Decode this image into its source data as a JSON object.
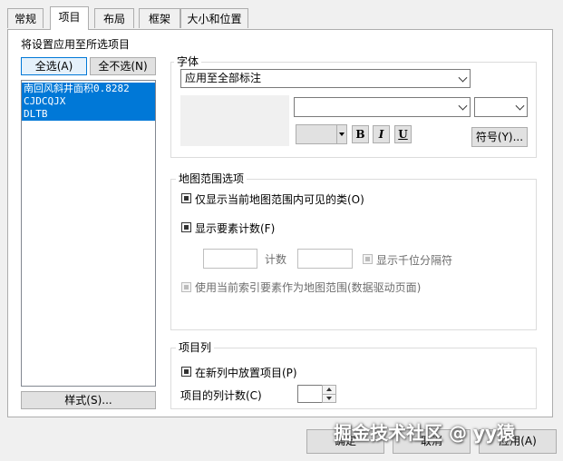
{
  "tabs": [
    "常规",
    "项目",
    "布局",
    "框架",
    "大小和位置"
  ],
  "active_tab": "项目",
  "left": {
    "title": "将设置应用至所选项目",
    "select_all": "全选(A)",
    "select_none": "全不选(N)",
    "items": [
      "南回风斜井面积0.8282",
      "CJDCQJX",
      "DLTB"
    ],
    "style_button": "样式(S)..."
  },
  "font_group": {
    "title": "字体",
    "apply_to": "应用至全部标注",
    "symbol_button": "符号(Y)...",
    "bold": "B",
    "italic": "I",
    "underline": "U"
  },
  "extent_group": {
    "title": "地图范围选项",
    "only_visible": "仅显示当前地图范围内可见的类(O)",
    "show_count": "显示要素计数(F)",
    "count_label": "计数",
    "thousands": "显示千位分隔符",
    "use_index": "使用当前索引要素作为地图范围(数据驱动页面)"
  },
  "column_group": {
    "title": "项目列",
    "new_column": "在新列中放置项目(P)",
    "column_count": "项目的列计数(C)"
  },
  "footer": {
    "ok": "确定",
    "cancel": "取消",
    "apply": "应用(A)"
  },
  "watermark": "掘金技术社区 @ yy猿",
  "colors": {
    "selection": "#0078d7",
    "panel": "#ffffff",
    "window": "#f0f0f0"
  }
}
